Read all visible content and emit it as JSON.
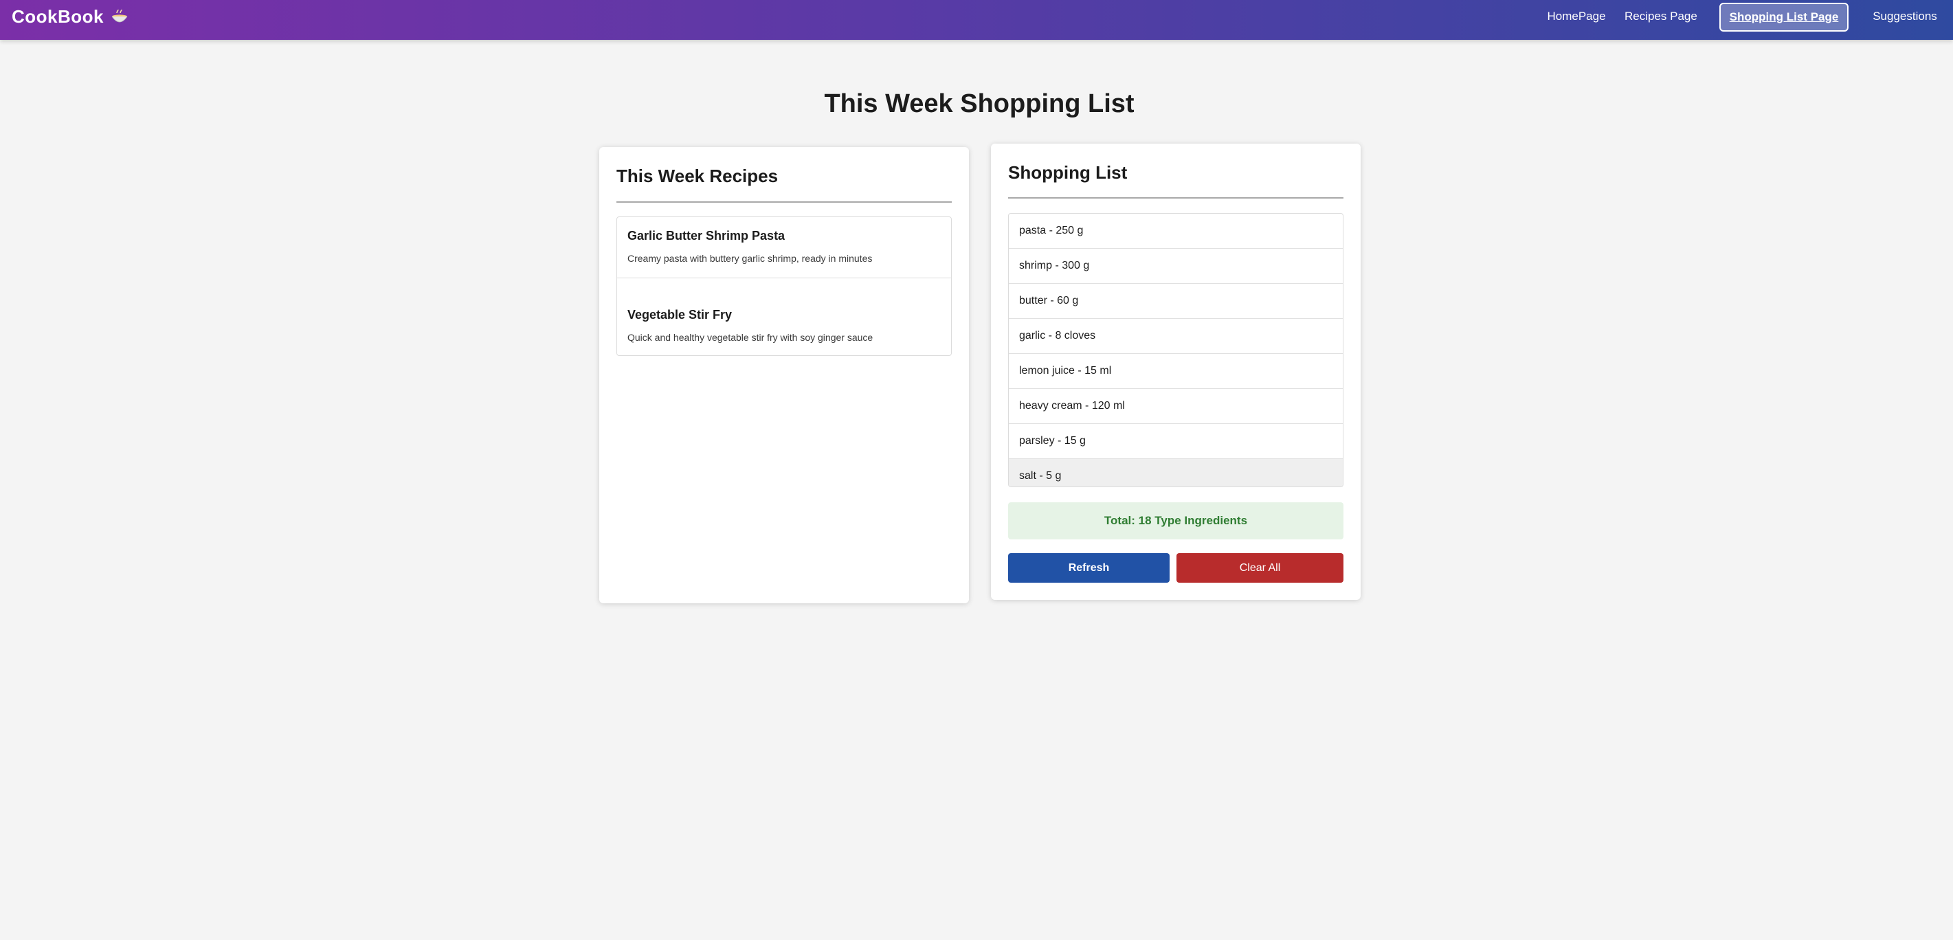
{
  "app": {
    "brand": "CookBook",
    "brand_icon": "bowl-icon"
  },
  "nav": {
    "items": [
      {
        "label": "HomePage"
      },
      {
        "label": "Recipes Page"
      },
      {
        "label": "Shopping List Page",
        "active": true
      },
      {
        "label": "Suggestions"
      }
    ]
  },
  "page": {
    "title": "This Week Shopping List"
  },
  "recipes": {
    "title": "This Week Recipes",
    "items": [
      {
        "name": "Garlic Butter Shrimp Pasta",
        "description": "Creamy pasta with buttery garlic shrimp, ready in minutes"
      },
      {
        "name": "Vegetable Stir Fry",
        "description": "Quick and healthy vegetable stir fry with soy ginger sauce"
      }
    ]
  },
  "shopping": {
    "title": "Shopping List",
    "items": [
      "pasta - 250 g",
      "shrimp - 300 g",
      "butter - 60 g",
      "garlic - 8 cloves",
      "lemon juice - 15 ml",
      "heavy cream - 120 ml",
      "parsley - 15 g",
      "salt - 5 g"
    ],
    "total": "Total: 18 Type Ingredients",
    "refresh_label": "Refresh",
    "clear_label": "Clear All"
  },
  "colors": {
    "nav_gradient_start": "#7b2fa8",
    "nav_gradient_end": "#2f4aa0",
    "refresh_button": "#2152a6",
    "clear_button": "#b82c2c",
    "total_background": "#e6f3e6",
    "total_text": "#2f7d32"
  }
}
